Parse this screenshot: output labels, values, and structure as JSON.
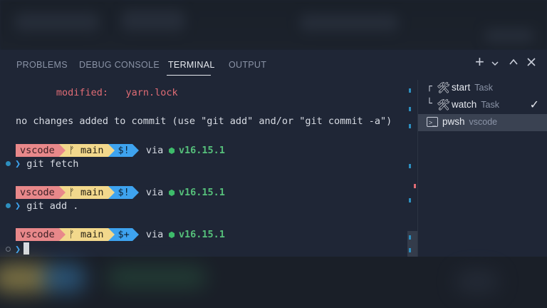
{
  "tabs": [
    {
      "label": "PROBLEMS",
      "active": false
    },
    {
      "label": "DEBUG CONSOLE",
      "active": false
    },
    {
      "label": "TERMINAL",
      "active": true
    },
    {
      "label": "OUTPUT",
      "active": false
    }
  ],
  "toolbar": {
    "add_icon": "plus-icon",
    "dropdown_icon": "chevron-down-icon",
    "maximize_icon": "chevron-up-icon",
    "close_icon": "close-icon"
  },
  "terminal": {
    "modified_label": "modified:",
    "modified_file": "yarn.lock",
    "status_line": "no changes added to commit (use \"git add\" and/or \"git commit -a\")",
    "prompts": [
      {
        "dir": "vscode",
        "branch": "main",
        "status": "$!",
        "via": "via",
        "node_version": "v16.15.1",
        "command": "git fetch"
      },
      {
        "dir": "vscode",
        "branch": "main",
        "status": "$!",
        "via": "via",
        "node_version": "v16.15.1",
        "command": "git add ."
      },
      {
        "dir": "vscode",
        "branch": "main",
        "status": "$+",
        "via": "via",
        "node_version": "v16.15.1",
        "command": ""
      }
    ],
    "branch_symbol": "ᚠ",
    "prompt_symbol": "❯"
  },
  "task_list": [
    {
      "name": "start",
      "type": "Task",
      "icon": "tools-icon",
      "tree": "┌",
      "selected": false
    },
    {
      "name": "watch",
      "type": "Task",
      "icon": "tools-icon",
      "tree": "└",
      "selected": false,
      "checked": true
    },
    {
      "name": "pwsh",
      "type": "vscode",
      "icon": "terminal-icon",
      "selected": true
    }
  ],
  "colors": {
    "panel_bg": "#1f2636",
    "accent_blue": "#3ea3ef",
    "seg_red": "#e8888a",
    "seg_yellow": "#f2d88c",
    "node_green": "#56c07b",
    "modified_red": "#e06c75"
  }
}
